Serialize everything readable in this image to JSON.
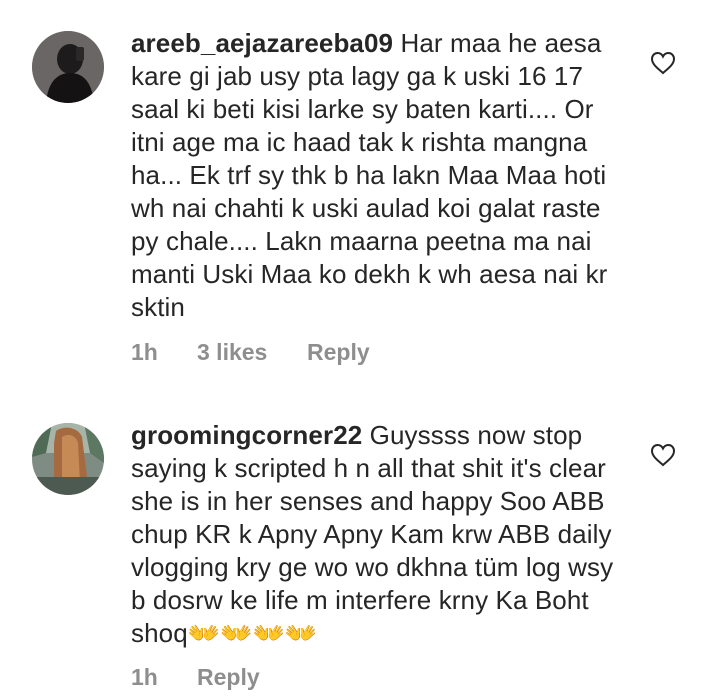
{
  "comments": [
    {
      "username": "areeb_aejazareeba09",
      "text": "Har maa he aesa kare gi jab usy pta lagy ga k uski 16 17 saal ki beti kisi larke sy baten karti.... Or itni age ma ic haad tak k rishta mangna ha... Ek trf sy thk b ha lakn Maa Maa hoti wh nai chahti k uski aulad koi galat raste py chale.... Lakn maarna peetna ma nai manti Uski Maa ko dekh k wh aesa nai kr sktin",
      "time": "1h",
      "likes": "3 likes",
      "reply": "Reply",
      "avatar_icon": "profile-photo-dark"
    },
    {
      "username": "groomingcorner22",
      "text": "Guyssss now stop saying k scripted h n all that shit it's clear she is in her senses and happy Soo ABB chup KR k Apny Apny Kam krw ABB daily vlogging kry ge  wo wo dkhna tüm log  wsy b dosrw ke life m interfere krny Ka Boht shoq",
      "emoji": "👐👐👐👐",
      "time": "1h",
      "reply": "Reply",
      "avatar_icon": "profile-photo-hair"
    }
  ],
  "colors": {
    "text": "#262626",
    "meta": "#8e8e8e",
    "heart_stroke": "#262626"
  }
}
